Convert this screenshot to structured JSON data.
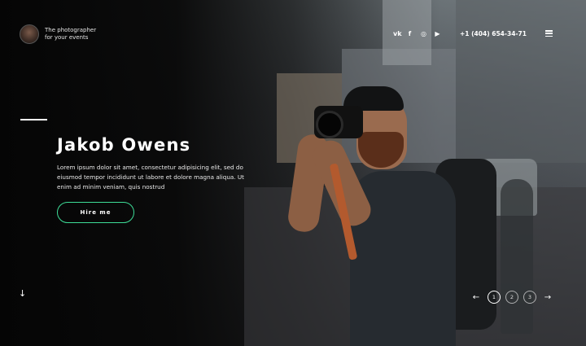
{
  "header": {
    "tagline_line1": "The photographer",
    "tagline_line2": "for your events",
    "social": [
      {
        "icon": "vk-icon",
        "glyph": "vk"
      },
      {
        "icon": "facebook-icon",
        "glyph": "f"
      },
      {
        "icon": "instagram-icon",
        "glyph": "◎"
      },
      {
        "icon": "youtube-icon",
        "glyph": "▶"
      }
    ],
    "phone": "+1 (404) 654-34-71"
  },
  "hero": {
    "title": "Jakob Owens",
    "description": "Lorem ipsum dolor sit amet, consectetur adipisicing elit, sed do eiusmod tempor incididunt ut labore et dolore magna aliqua. Ut enim ad minim veniam, quis nostrud",
    "cta_label": "Hire me",
    "accent_color": "#3ddc97"
  },
  "navigation": {
    "scroll_down": "↓",
    "prev": "←",
    "next": "→",
    "pages": [
      "1",
      "2",
      "3"
    ],
    "active_page": "1"
  }
}
